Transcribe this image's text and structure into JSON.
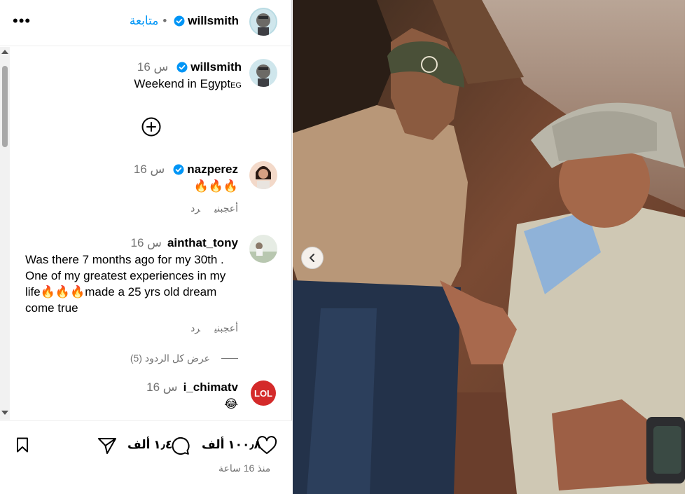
{
  "header": {
    "username": "willsmith",
    "follow_label": "متابعة",
    "separator": "•"
  },
  "caption": {
    "username": "willsmith",
    "time": "16 س",
    "text": "Weekend in Egypt",
    "flag": "EG"
  },
  "comments": [
    {
      "username": "nazperez",
      "verified": true,
      "time": "16 س",
      "text": "🔥🔥🔥",
      "like_label": "أعجبني",
      "reply_label": "رد"
    },
    {
      "username": "ainthat_tony",
      "verified": false,
      "time": "16 س",
      "text": "Was there 7 months ago for my 30th . One of my greatest experiences in my life🔥🔥🔥made a 25 yrs old dream come true",
      "like_label": "أعجبني",
      "reply_label": "رد",
      "view_replies_label": "عرض كل الردود (5)"
    },
    {
      "username": "i_chimatv",
      "verified": false,
      "time": "16 س",
      "text": "😂"
    }
  ],
  "footer": {
    "likes": "١٠٠٫٨ ألف",
    "comments": "١٫٤ ألف",
    "timestamp": "منذ 16 ساعة"
  },
  "icons": {
    "more": "more-options-icon",
    "verified": "verified-badge-icon",
    "load_more": "plus-circle-icon",
    "heart": "heart-icon",
    "comment": "comment-icon",
    "share": "send-icon",
    "bookmark": "bookmark-icon",
    "prev": "chevron-left-icon"
  },
  "colors": {
    "accent": "#0095f6",
    "verified": "#0095f6",
    "muted_text": "#737373"
  }
}
